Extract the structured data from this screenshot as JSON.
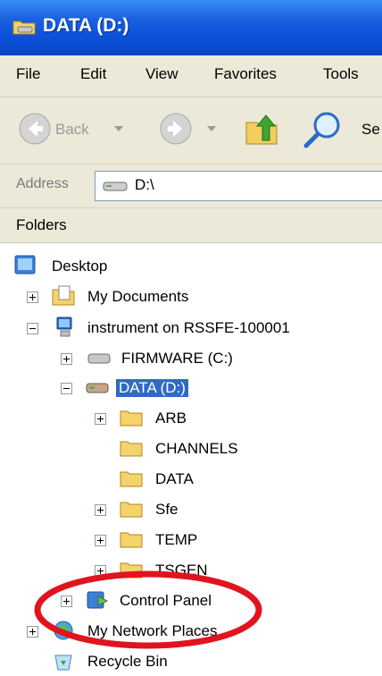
{
  "window": {
    "title": "DATA (D:)"
  },
  "menu": {
    "items": [
      "File",
      "Edit",
      "View",
      "Favorites",
      "Tools"
    ]
  },
  "toolbar": {
    "back_label": "Back",
    "search_label_partial": "Se"
  },
  "address": {
    "label": "Address",
    "value": "D:\\"
  },
  "folders": {
    "header": "Folders"
  },
  "tree": {
    "desktop": "Desktop",
    "my_documents": "My Documents",
    "instrument": "instrument on RSSFE-100001",
    "firmware": "FIRMWARE (C:)",
    "data_drive": "DATA (D:)",
    "arb": "ARB",
    "channels": "CHANNELS",
    "data_folder": "DATA",
    "sfe": "Sfe",
    "temp": "TEMP",
    "tsgen": "TSGEN",
    "control_panel": "Control Panel",
    "network": "My Network Places",
    "recycle": "Recycle Bin"
  },
  "colors": {
    "titlebar": "#0b4fd8",
    "selection": "#316ac5",
    "annotation": "#e0141e",
    "chrome": "#ece9d8"
  },
  "icons": [
    "drive-icon",
    "back-icon",
    "forward-icon",
    "up-folder-icon",
    "search-icon",
    "desktop-icon",
    "documents-icon",
    "computer-icon",
    "folder-icon",
    "control-panel-icon",
    "network-icon",
    "recycle-bin-icon"
  ]
}
